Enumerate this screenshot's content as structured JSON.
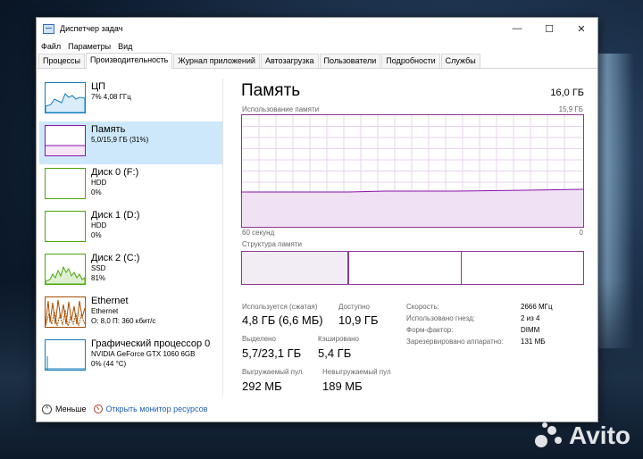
{
  "window": {
    "title": "Диспетчер задач",
    "controls": {
      "minimize": "—",
      "maximize": "☐",
      "close": "✕"
    }
  },
  "menu": [
    "Файл",
    "Параметры",
    "Вид"
  ],
  "tabs": [
    "Процессы",
    "Производительность",
    "Журнал приложений",
    "Автозагрузка",
    "Пользователи",
    "Подробности",
    "Службы"
  ],
  "active_tab": "Производительность",
  "sidebar": {
    "items": [
      {
        "name": "ЦП",
        "sub1": "7% 4,08 ГГц",
        "sub2": "",
        "sub3": "",
        "color": "#117dbb"
      },
      {
        "name": "Память",
        "sub1": "5,0/15,9 ГБ (31%)",
        "sub2": "",
        "sub3": "",
        "color": "#8b12ae"
      },
      {
        "name": "Диск 0 (F:)",
        "sub1": "HDD",
        "sub2": "0%",
        "sub3": "",
        "color": "#4da60c"
      },
      {
        "name": "Диск 1 (D:)",
        "sub1": "HDD",
        "sub2": "0%",
        "sub3": "",
        "color": "#4da60c"
      },
      {
        "name": "Диск 2 (C:)",
        "sub1": "SSD",
        "sub2": "81%",
        "sub3": "",
        "color": "#4da60c"
      },
      {
        "name": "Ethernet",
        "sub1": "Ethernet",
        "sub2": "О: 8,0 П: 360 кбит/с",
        "sub3": "",
        "color": "#a74f01"
      },
      {
        "name": "Графический процессор 0",
        "sub1": "NVIDIA GeForce GTX 1060 6GB",
        "sub2": "0% (44 °C)",
        "sub3": "",
        "color": "#117dbb"
      }
    ]
  },
  "main": {
    "heading": "Память",
    "total": "16,0 ГБ",
    "usage_label": "Использование памяти",
    "usage_max": "15,9 ГБ",
    "axis_left": "60 секунд",
    "axis_right": "0",
    "structure_label": "Структура памяти",
    "stats": {
      "in_use_label": "Используется (сжатая)",
      "in_use_value": "4,8 ГБ (6,6 МБ)",
      "available_label": "Доступно",
      "available_value": "10,9 ГБ",
      "committed_label": "Выделено",
      "committed_value": "5,7/23,1 ГБ",
      "cached_label": "Кэшировано",
      "cached_value": "5,4 ГБ",
      "paged_label": "Выгружаемый пул",
      "paged_value": "292 МБ",
      "nonpaged_label": "Невыгружаемый пул",
      "nonpaged_value": "189 МБ"
    },
    "details": [
      {
        "k": "Скорость:",
        "v": "2666 МГц"
      },
      {
        "k": "Использовано гнезд:",
        "v": "2 из 4"
      },
      {
        "k": "Форм-фактор:",
        "v": "DIMM"
      },
      {
        "k": "Зарезервировано аппаратно:",
        "v": "131 МБ"
      }
    ]
  },
  "footer": {
    "less": "Меньше",
    "monitor": "Открыть монитор ресурсов"
  },
  "watermark": "Avito",
  "colors": {
    "memory": "#8b12ae",
    "cpu": "#117dbb",
    "disk": "#4da60c",
    "ethernet": "#a74f01",
    "selected": "#cde8fa"
  }
}
